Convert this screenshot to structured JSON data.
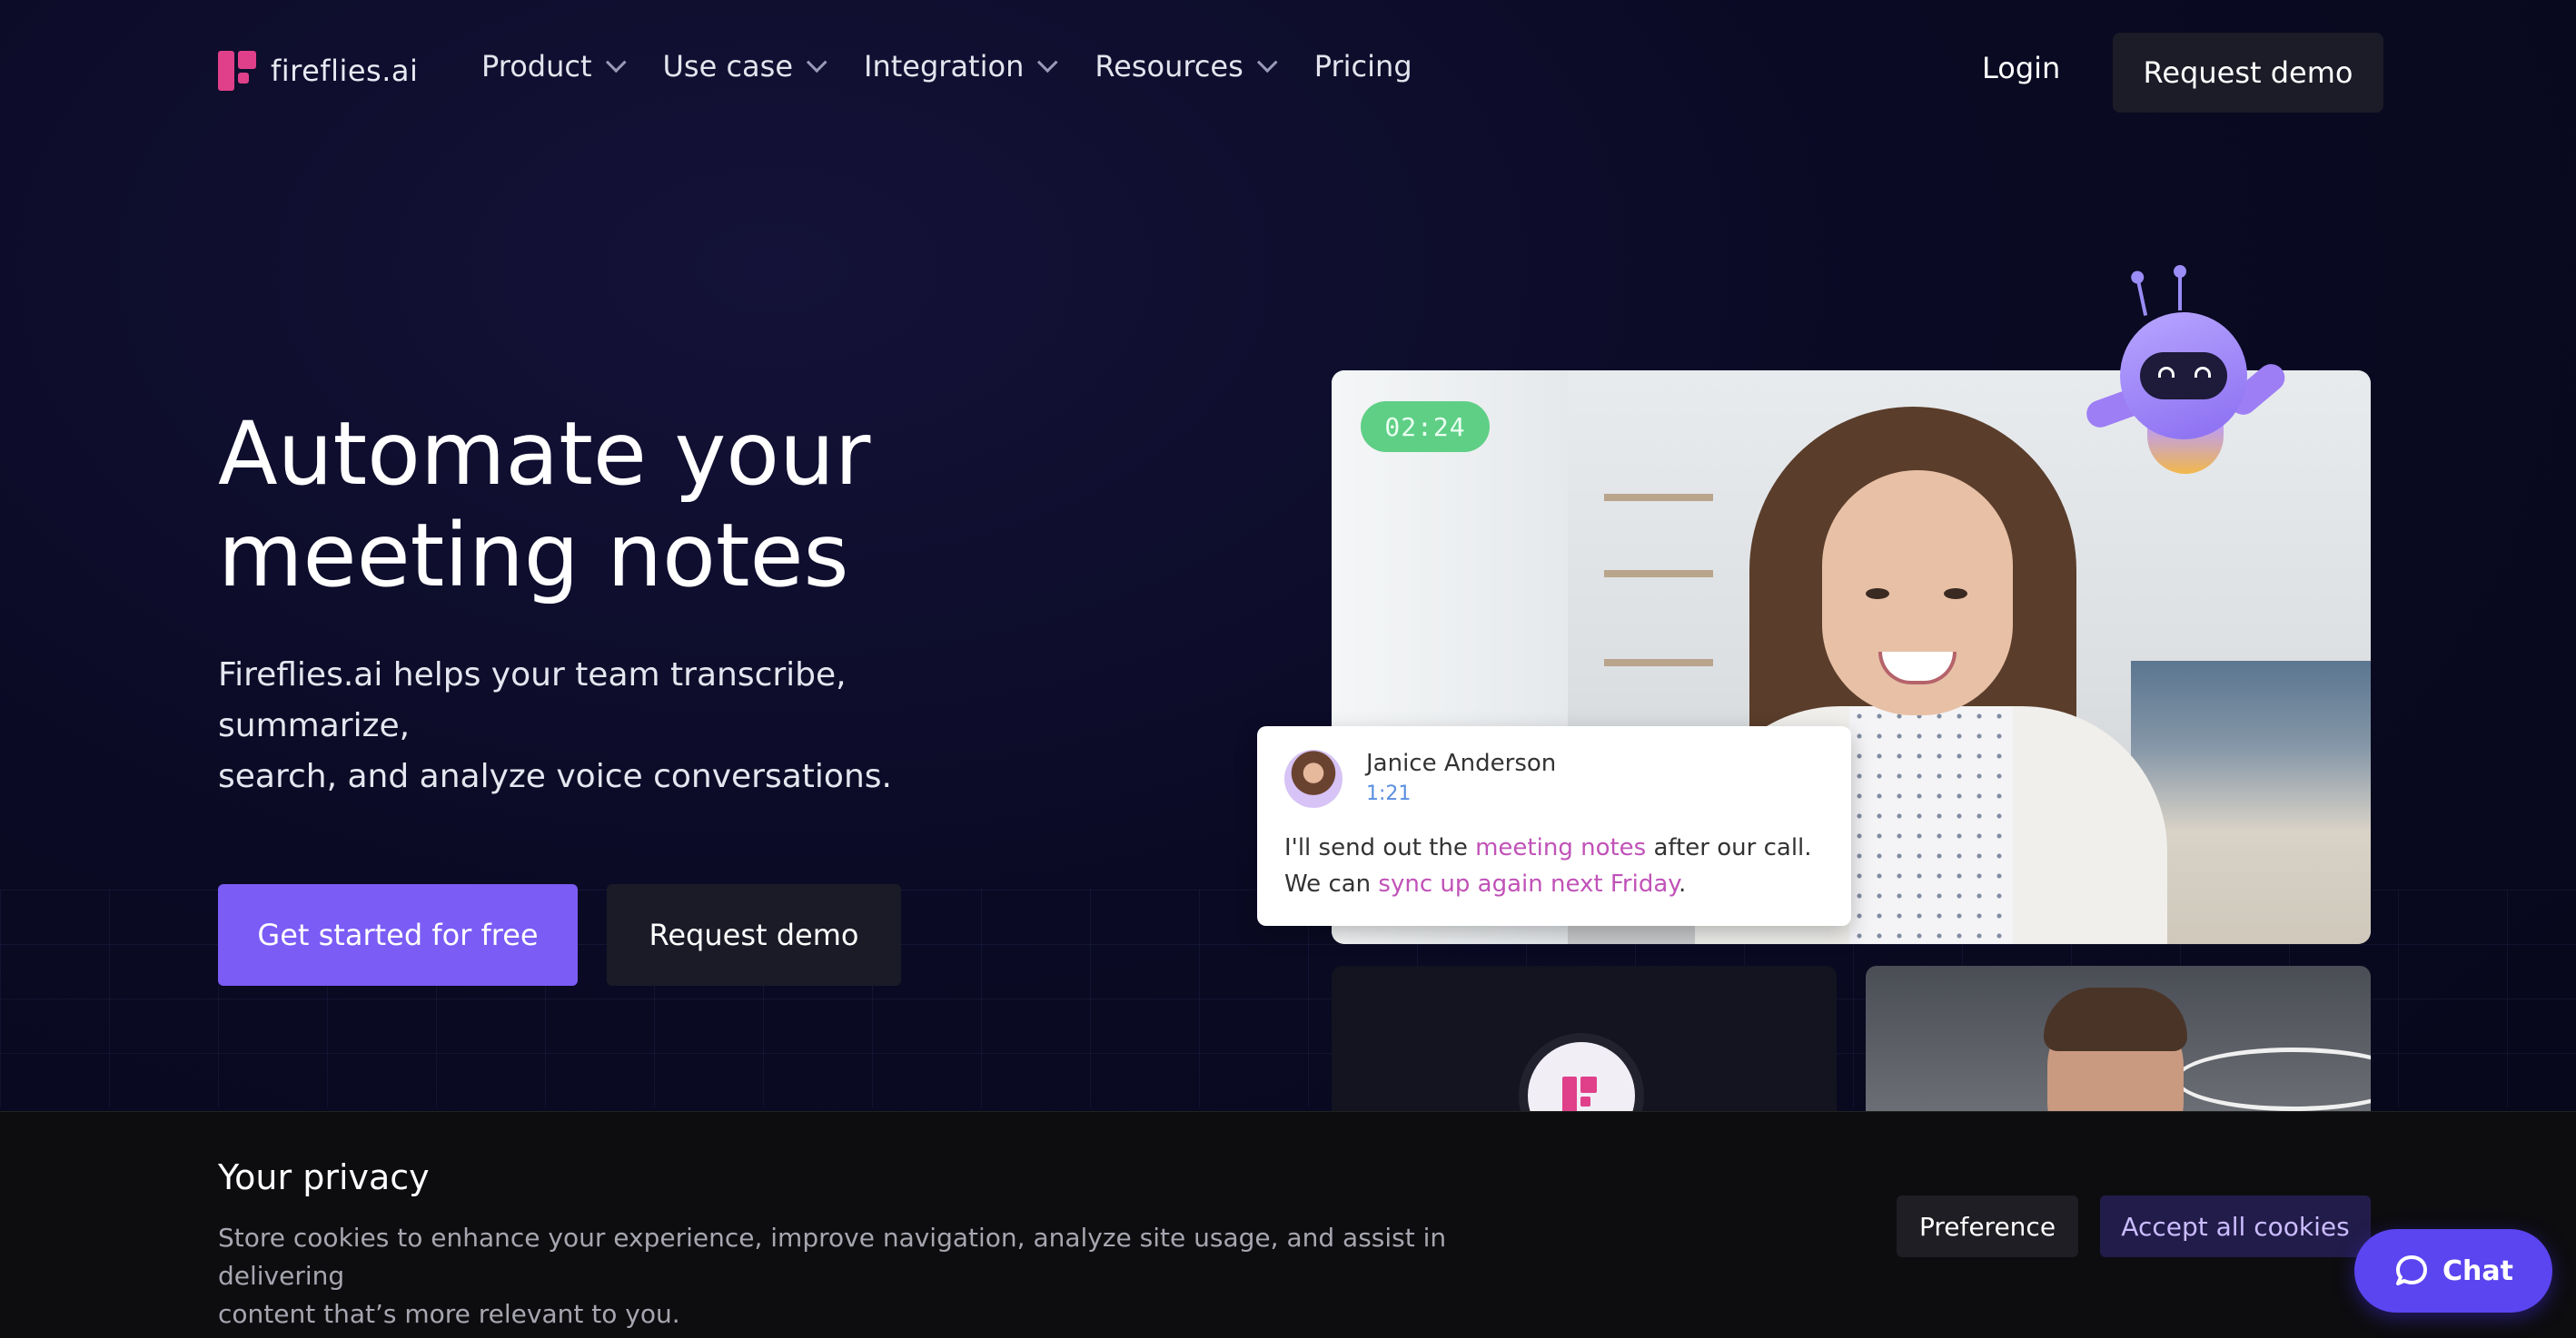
{
  "brand": {
    "name": "fireflies.ai",
    "accent": "#7b5cf5",
    "logo_color": "#e0408a"
  },
  "nav": {
    "items": [
      {
        "label": "Product",
        "has_dropdown": true
      },
      {
        "label": "Use case",
        "has_dropdown": true
      },
      {
        "label": "Integration",
        "has_dropdown": true
      },
      {
        "label": "Resources",
        "has_dropdown": true
      },
      {
        "label": "Pricing",
        "has_dropdown": false
      }
    ],
    "login": "Login",
    "request_demo": "Request demo"
  },
  "hero": {
    "title_line1": "Automate your",
    "title_line2": "meeting notes",
    "subtitle_line1": "Fireflies.ai helps your team transcribe, summarize,",
    "subtitle_line2": "search, and analyze voice conversations.",
    "cta_primary": "Get started for free",
    "cta_secondary": "Request demo"
  },
  "video": {
    "timer": "02:24",
    "transcript": {
      "speaker": "Janice Anderson",
      "timestamp": "1:21",
      "text_part1": "I'll send out the ",
      "highlight1": "meeting notes",
      "text_part2": " after our call. We can ",
      "highlight2": "sync up again next Friday",
      "text_part3": "."
    },
    "highlight_color": "#c052b8",
    "timer_color": "#5fcf86"
  },
  "cookie": {
    "title": "Your privacy",
    "text_line1": "Store cookies to enhance your experience, improve navigation, analyze site usage, and assist in delivering",
    "text_line2": "content that’s more relevant to you.",
    "preference": "Preference",
    "accept": "Accept all cookies"
  },
  "chat": {
    "label": "Chat",
    "icon": "chat-bubble-icon"
  }
}
